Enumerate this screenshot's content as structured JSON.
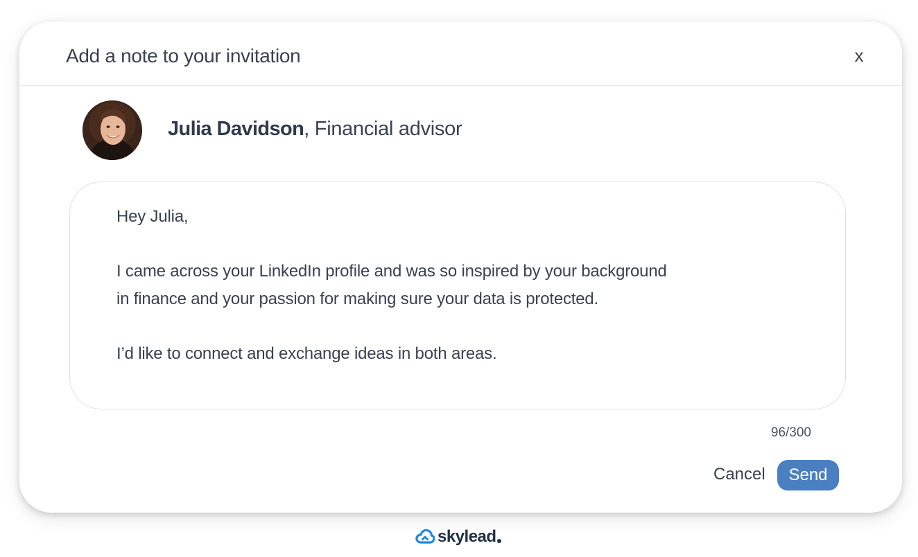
{
  "dialog": {
    "title": "Add a note to your invitation",
    "close_label": "x"
  },
  "recipient": {
    "name": "Julia Davidson",
    "separator": ", ",
    "headline": "Financial advisor",
    "avatar_icon": "profile-photo"
  },
  "note": {
    "lines": [
      "Hey Julia,",
      "",
      "I came across your LinkedIn profile and was so inspired by your background",
      "in finance and your passion for making sure your data is protected.",
      "",
      "I’d like to connect and exchange ideas in both areas."
    ],
    "char_count": "96/300"
  },
  "actions": {
    "cancel_label": "Cancel",
    "send_label": "Send",
    "send_color": "#4a7fc1"
  },
  "branding": {
    "name": "skylead",
    "icon": "cloud-logo-icon",
    "accent": "#1e88e5"
  }
}
